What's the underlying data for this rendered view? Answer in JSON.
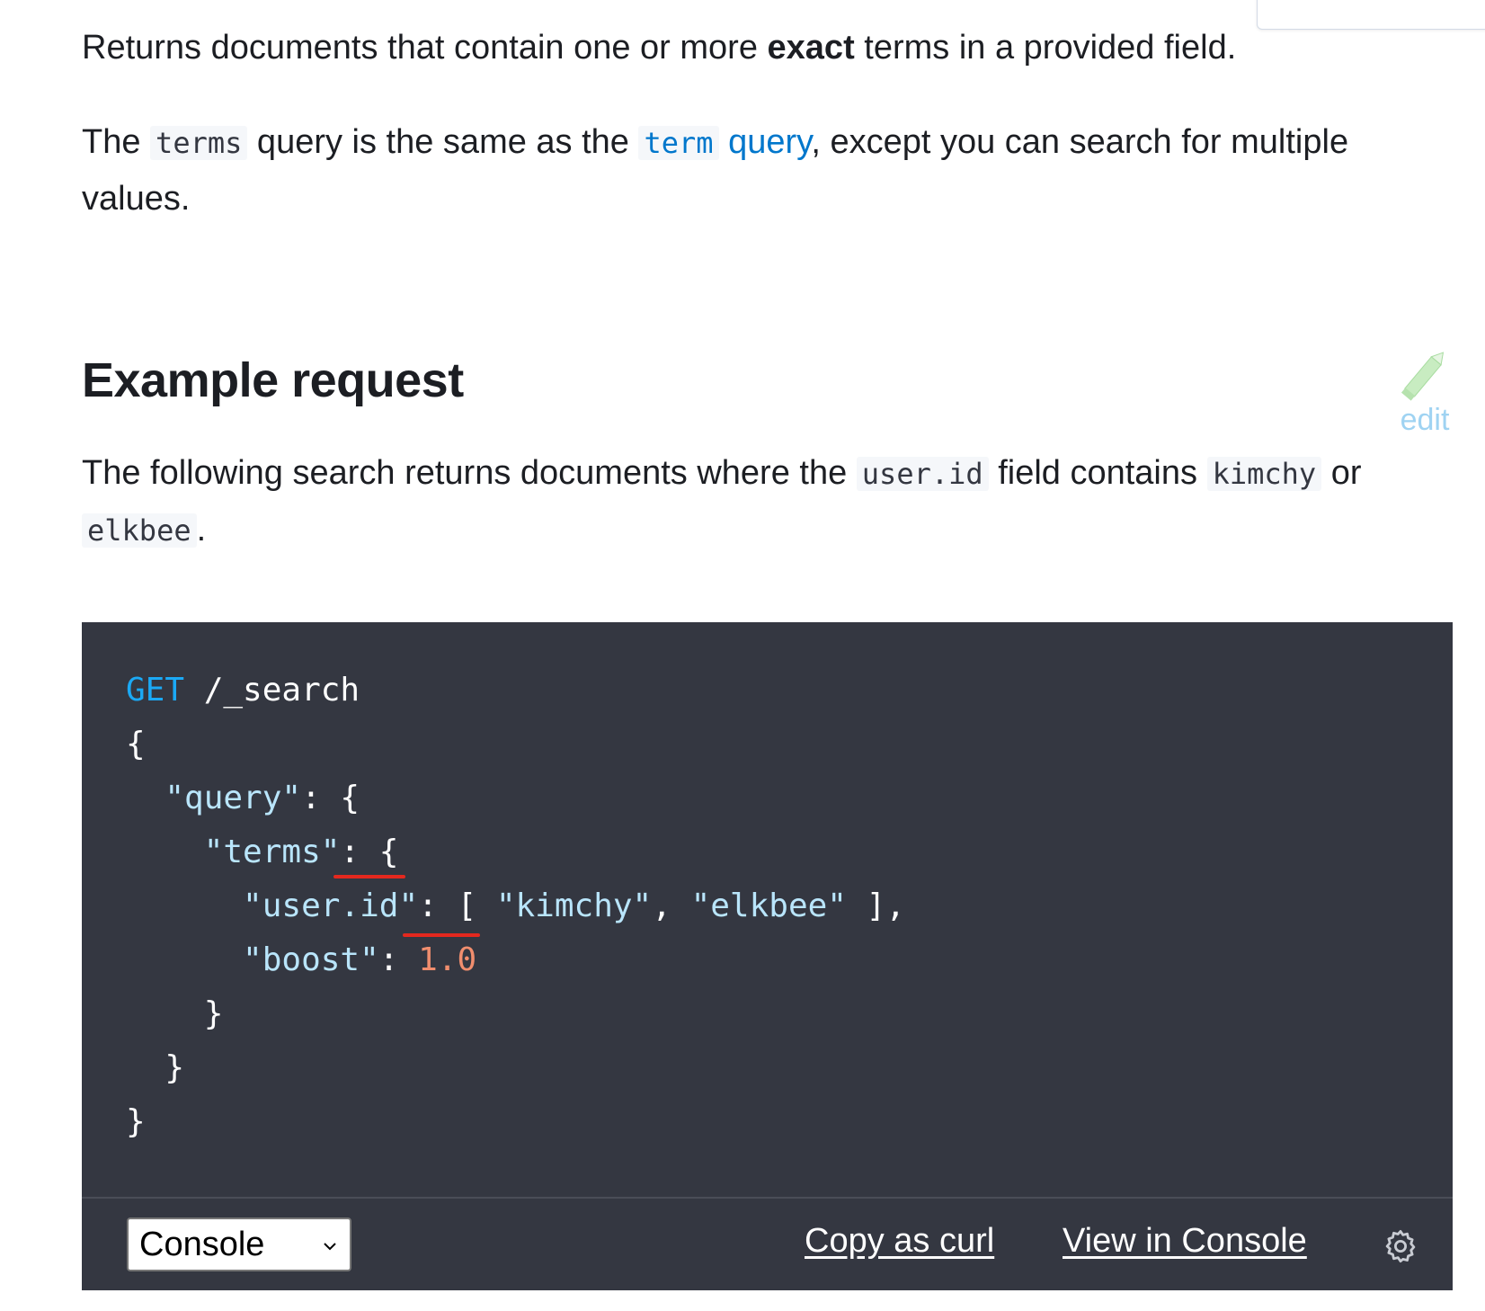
{
  "intro": {
    "p1_before": "Returns documents that contain one or more ",
    "p1_bold": "exact",
    "p1_after": " terms in a provided field.",
    "p2_the": "The ",
    "p2_code_terms": "terms",
    "p2_mid": " query is the same as the ",
    "p2_link_code": "term",
    "p2_link_text": " query",
    "p2_after": ", except you can search for multiple values."
  },
  "section": {
    "heading": "Example request",
    "edit_label": "edit",
    "desc_before": "The following search returns documents where the ",
    "desc_code_field": "user.id",
    "desc_mid": " field contains ",
    "desc_code_v1": "kimchy",
    "desc_or": " or ",
    "desc_code_v2": "elkbee",
    "desc_end": "."
  },
  "code": {
    "method": "GET",
    "path": " /_search",
    "l2": "{",
    "l3_key": "\"query\"",
    "l3_rest": ": {",
    "l4_key": "\"terms\"",
    "l4_rest": ": {",
    "l5_key": "\"user.id\"",
    "l5_sep": ": [ ",
    "l5_v1": "\"kimchy\"",
    "l5_comma": ", ",
    "l5_v2": "\"elkbee\"",
    "l5_end": " ],",
    "l6_key": "\"boost\"",
    "l6_sep": ": ",
    "l6_val": "1.0",
    "l7": "}",
    "l8": "}",
    "l9": "}"
  },
  "footer": {
    "select_value": "Console",
    "copy_curl": "Copy as curl",
    "view_console": "View in Console"
  },
  "colors": {
    "code_bg": "#343741",
    "link": "#0077cc",
    "get": "#1ba9f5",
    "string": "#b9e5fb",
    "number": "#f18e6e",
    "annotation": "#e4281e",
    "edit": "#9fd3f2"
  },
  "icons": {
    "edit": "pencil-icon",
    "select": "chevron-down-icon",
    "settings": "gear-icon"
  }
}
